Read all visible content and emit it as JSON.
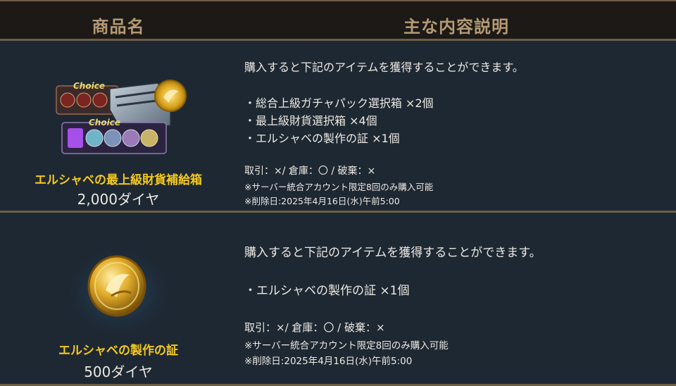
{
  "header": {
    "col_product": "商品名",
    "col_description": "主な内容説明"
  },
  "colors": {
    "header_bg": "#1c1916",
    "header_text": "#b39a74",
    "row_bg": "#1e2833",
    "divider": "#6d5e46",
    "product_title": "#f3c81d",
    "text": "#ece9e2"
  },
  "rows": [
    {
      "product": {
        "icon": "chest-and-coin-bundle-icon",
        "badge_text": "Choice",
        "title": "エルシャベの最上級財貨補給箱",
        "price": "2,000ダイヤ"
      },
      "description": {
        "lead": "購入すると下記のアイテムを獲得することができます。",
        "items": [
          "・総合上級ガチャパック選択箱 ×2個",
          "・最上級財貨選択箱 ×4個",
          "・エルシャベの製作の証 ×1個"
        ],
        "flags": "取引：×/ 倉庫：〇 / 破棄：×",
        "notes": [
          "※サーバー統合アカウント限定8回のみ購入可能",
          "※削除日:2025年4月16日(水)午前5:00"
        ]
      }
    },
    {
      "product": {
        "icon": "gold-coin-icon",
        "title": "エルシャベの製作の証",
        "price": "500ダイヤ"
      },
      "description": {
        "lead": "購入すると下記のアイテムを獲得することができます。",
        "items": [
          "・エルシャベの製作の証 ×1個"
        ],
        "flags": "取引：×/ 倉庫：〇 / 破棄：×",
        "notes": [
          "※サーバー統合アカウント限定8回のみ購入可能",
          "※削除日:2025年4月16日(水)午前5:00"
        ]
      }
    }
  ]
}
